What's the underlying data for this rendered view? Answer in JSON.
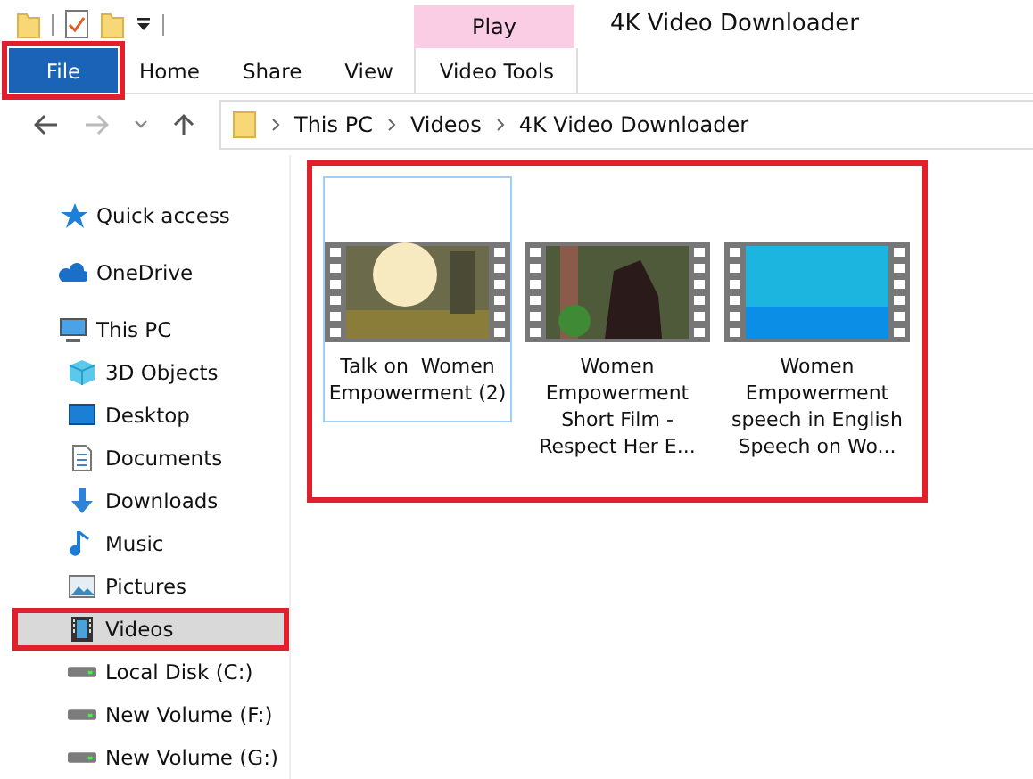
{
  "window": {
    "title": "4K Video Downloader"
  },
  "context_tab": {
    "label": "Play"
  },
  "tabs": [
    {
      "label": "File",
      "kind": "file",
      "selected": false,
      "highlighted": true
    },
    {
      "label": "Home",
      "kind": "normal",
      "selected": false,
      "highlighted": false
    },
    {
      "label": "Share",
      "kind": "normal",
      "selected": false,
      "highlighted": false
    },
    {
      "label": "View",
      "kind": "normal",
      "selected": false,
      "highlighted": false
    },
    {
      "label": "Video Tools",
      "kind": "context",
      "selected": false,
      "highlighted": false
    }
  ],
  "address": {
    "segments": [
      "This PC",
      "Videos",
      "4K Video Downloader"
    ]
  },
  "sidebar": {
    "items": [
      {
        "label": "Quick access",
        "kind": "star",
        "selected": false,
        "highlighted": false
      },
      {
        "label": "OneDrive",
        "kind": "cloud",
        "selected": false,
        "highlighted": false
      },
      {
        "label": "This PC",
        "kind": "pc",
        "selected": false,
        "highlighted": false,
        "children": [
          {
            "label": "3D Objects",
            "kind": "cube",
            "selected": false,
            "highlighted": false
          },
          {
            "label": "Desktop",
            "kind": "desktop",
            "selected": false,
            "highlighted": false
          },
          {
            "label": "Documents",
            "kind": "doc",
            "selected": false,
            "highlighted": false
          },
          {
            "label": "Downloads",
            "kind": "download",
            "selected": false,
            "highlighted": false
          },
          {
            "label": "Music",
            "kind": "music",
            "selected": false,
            "highlighted": false
          },
          {
            "label": "Pictures",
            "kind": "pictures",
            "selected": false,
            "highlighted": false
          },
          {
            "label": "Videos",
            "kind": "video",
            "selected": true,
            "highlighted": true
          },
          {
            "label": "Local Disk (C:)",
            "kind": "drive",
            "selected": false,
            "highlighted": false
          },
          {
            "label": "New Volume (F:)",
            "kind": "drive",
            "selected": false,
            "highlighted": false
          },
          {
            "label": "New Volume (G:)",
            "kind": "drive",
            "selected": false,
            "highlighted": false
          }
        ]
      }
    ]
  },
  "files": {
    "highlighted": true,
    "items": [
      {
        "name": "Talk on  Women Empowerment (2)",
        "selected": true
      },
      {
        "name": "Women Empowerment Short Film - Respect Her E...",
        "selected": false
      },
      {
        "name": "Women Empowerment speech in English Speech on Wo...",
        "selected": false
      }
    ]
  }
}
